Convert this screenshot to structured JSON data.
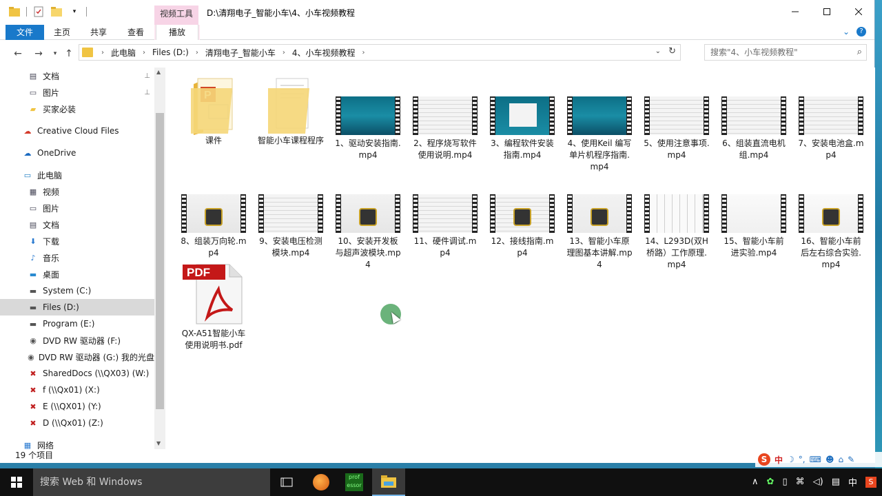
{
  "window": {
    "title": "D:\\清翔电子_智能小车\\4、小车视频教程",
    "context_group": "视频工具"
  },
  "ribbon": {
    "tabs": [
      "文件",
      "主页",
      "共享",
      "查看",
      "播放"
    ]
  },
  "address": {
    "crumbs": [
      "此电脑",
      "Files (D:)",
      "清翔电子_智能小车",
      "4、小车视频教程"
    ]
  },
  "search": {
    "placeholder": "搜索\"4、小车视频教程\""
  },
  "nav": {
    "items": [
      {
        "label": "文档",
        "icon": "documents-icon",
        "pinned": true
      },
      {
        "label": "图片",
        "icon": "pictures-icon",
        "pinned": true
      },
      {
        "label": "买家必装",
        "icon": "folder-icon"
      },
      {
        "label": "Creative Cloud Files",
        "icon": "creative-cloud-icon"
      },
      {
        "label": "OneDrive",
        "icon": "onedrive-icon"
      },
      {
        "label": "此电脑",
        "icon": "this-pc-icon"
      },
      {
        "label": "视频",
        "icon": "videos-icon"
      },
      {
        "label": "图片",
        "icon": "pictures-icon"
      },
      {
        "label": "文档",
        "icon": "documents-icon"
      },
      {
        "label": "下载",
        "icon": "downloads-icon"
      },
      {
        "label": "音乐",
        "icon": "music-icon"
      },
      {
        "label": "桌面",
        "icon": "desktop-icon"
      },
      {
        "label": "System (C:)",
        "icon": "drive-icon"
      },
      {
        "label": "Files (D:)",
        "icon": "drive-icon",
        "selected": true
      },
      {
        "label": "Program (E:)",
        "icon": "drive-icon"
      },
      {
        "label": "DVD RW 驱动器 (F:)",
        "icon": "dvd-drive-icon"
      },
      {
        "label": "DVD RW 驱动器 (G:) 我的光盘",
        "icon": "dvd-drive-icon"
      },
      {
        "label": "SharedDocs (\\\\QX03) (W:)",
        "icon": "network-drive-disconnected-icon"
      },
      {
        "label": "f (\\\\Qx01) (X:)",
        "icon": "network-drive-disconnected-icon"
      },
      {
        "label": "E (\\\\QX01) (Y:)",
        "icon": "network-drive-disconnected-icon"
      },
      {
        "label": "D (\\\\Qx01) (Z:)",
        "icon": "network-drive-disconnected-icon"
      },
      {
        "label": "网络",
        "icon": "network-icon"
      }
    ]
  },
  "files": [
    {
      "name": "课件",
      "kind": "folder-ppt"
    },
    {
      "name": "智能小车课程程序",
      "kind": "folder-doc"
    },
    {
      "name": "1、驱动安装指南.mp4",
      "kind": "video",
      "thumb": "ocean"
    },
    {
      "name": "2、程序烧写软件使用说明.mp4",
      "kind": "video",
      "thumb": "doc"
    },
    {
      "name": "3、编程软件安装指南.mp4",
      "kind": "video",
      "thumb": "ocean-dialog"
    },
    {
      "name": "4、使用Keil 编写单片机程序指南.mp4",
      "kind": "video",
      "thumb": "ocean"
    },
    {
      "name": "5、使用注意事项.mp4",
      "kind": "video",
      "thumb": "doc"
    },
    {
      "name": "6、组装直流电机组.mp4",
      "kind": "video",
      "thumb": "doc"
    },
    {
      "name": "7、安装电池盒.mp4",
      "kind": "video",
      "thumb": "doc"
    },
    {
      "name": "8、组装万向轮.mp4",
      "kind": "video",
      "thumb": "robot"
    },
    {
      "name": "9、安装电压检测模块.mp4",
      "kind": "video",
      "thumb": "doc"
    },
    {
      "name": "10、安装开发板与超声波模块.mp4",
      "kind": "video",
      "thumb": "robot"
    },
    {
      "name": "11、硬件调试.mp4",
      "kind": "video",
      "thumb": "doc"
    },
    {
      "name": "12、接线指南.mp4",
      "kind": "video",
      "thumb": "doc-part"
    },
    {
      "name": "13、智能小车原理图基本讲解.mp4",
      "kind": "video",
      "thumb": "board"
    },
    {
      "name": "14、L293D(双H桥路）工作原理.mp4",
      "kind": "video",
      "thumb": "schematic"
    },
    {
      "name": "15、智能小车前进实验.mp4",
      "kind": "video",
      "thumb": "diagram"
    },
    {
      "name": "16、智能小车前后左右综合实验.mp4",
      "kind": "video",
      "thumb": "diagram-board"
    },
    {
      "name": "QX-A51智能小车使用说明书.pdf",
      "kind": "pdf"
    }
  ],
  "status": {
    "count": "19 个项目"
  },
  "taskbar": {
    "search_placeholder": "搜索 Web 和 Windows",
    "apps": [
      "task-view",
      "fireworks",
      "professor",
      "file-explorer"
    ],
    "tray_ime": "中"
  },
  "ime_bar": {
    "mode": "中"
  },
  "colors": {
    "accent": "#1979ca",
    "context_tab": "#f7d4e6",
    "folder": "#f0c443"
  }
}
